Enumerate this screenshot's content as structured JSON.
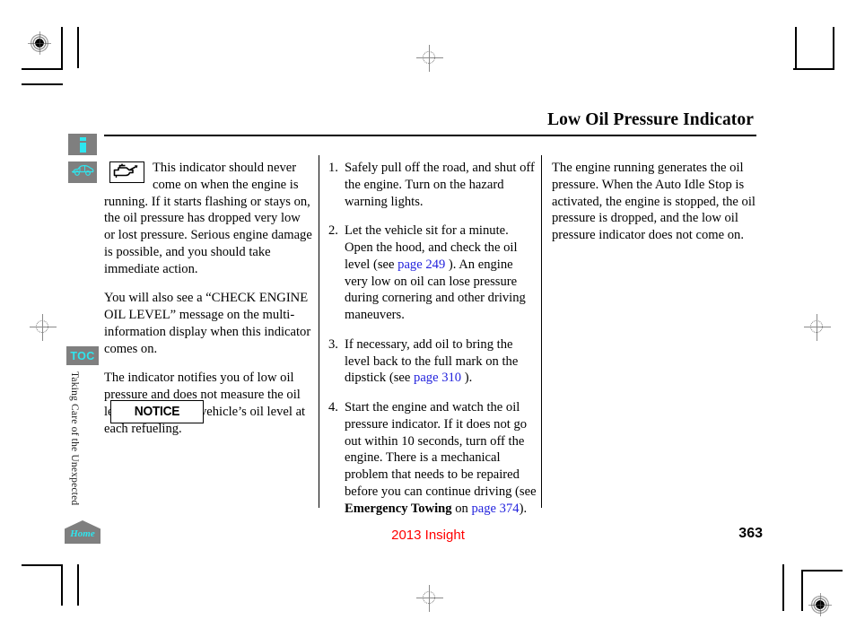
{
  "page": {
    "title": "Low Oil Pressure Indicator",
    "footer_model": "2013 Insight",
    "footer_page_number": "363"
  },
  "sidebar": {
    "info_button": {
      "name": "information",
      "icon": "info-icon"
    },
    "vehicle_button": {
      "name": "vehicle",
      "icon": "car-icon"
    },
    "toc_button": {
      "label": "TOC"
    },
    "section_label": "Taking Care of the Unexpected",
    "home_button": {
      "label": "Home"
    }
  },
  "column1": {
    "indicator_icon": "oil-can-icon",
    "paragraph1": "This indicator should never come on when the engine is running. If it starts flashing or stays on, the oil pressure has dropped very low or lost pressure. Serious engine damage is possible, and you should take immediate action.",
    "paragraph2": "You will also see a “CHECK ENGINE OIL LEVEL” message on the multi-information display when this indicator comes on.",
    "paragraph3": "The indicator notifies you of low oil pressure and does not measure the oil level. Check your vehicle’s oil level at each refueling.",
    "notice_label": "NOTICE"
  },
  "column2": {
    "steps": [
      {
        "number": "1.",
        "text_before": "Safely pull off the road, and shut off the engine. Turn on the hazard warning lights.",
        "link": "",
        "text_after": ""
      },
      {
        "number": "2.",
        "text_before": "Let the vehicle sit for a minute. Open the hood, and check the oil level (see ",
        "link": "page 249",
        "text_after": " ). An engine very low on oil can lose pressure during cornering and other driving maneuvers."
      },
      {
        "number": "3.",
        "text_before": "If necessary, add oil to bring the level back to the full mark on the dipstick (see ",
        "link": "page 310",
        "text_after": " )."
      },
      {
        "number": "4.",
        "text_before": "Start the engine and watch the oil pressure indicator. If it does not go out within 10 seconds, turn off the engine. There is a mechanical problem that needs to be repaired before you can continue driving (see ",
        "bold_term": "Emergency Towing",
        "text_mid": " on ",
        "link": "page 374",
        "text_after": ")."
      }
    ]
  },
  "column3": {
    "paragraph1": "The engine running generates the oil pressure. When the Auto Idle Stop is activated, the engine is stopped, the oil pressure is dropped, and the low oil pressure indicator does not come on."
  },
  "colors": {
    "link": "#2222dd",
    "footer_model": "#ff0000",
    "rail_button_bg": "#7f7f7f",
    "rail_button_fg": "#2ee6ef"
  }
}
